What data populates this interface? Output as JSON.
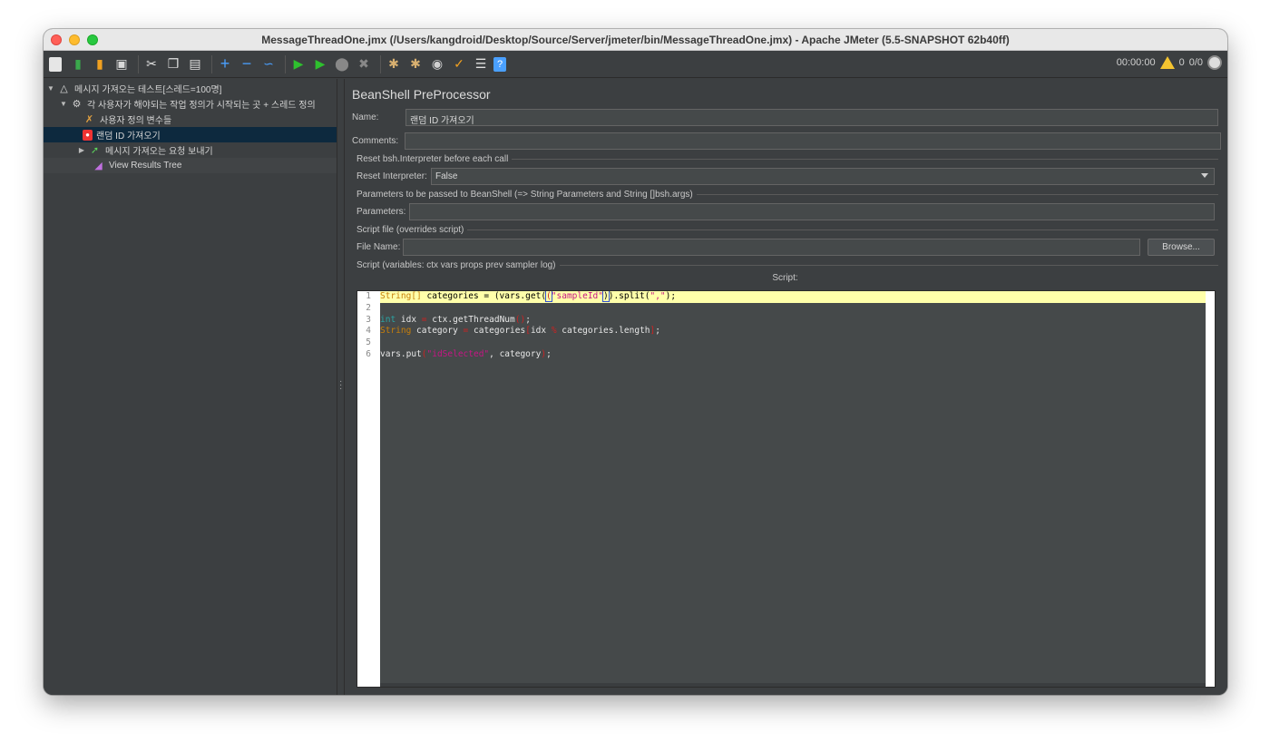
{
  "window": {
    "title": "MessageThreadOne.jmx (/Users/kangdroid/Desktop/Source/Server/jmeter/bin/MessageThreadOne.jmx) - Apache JMeter (5.5-SNAPSHOT 62b40ff)"
  },
  "toolbar": {
    "timer": "00:00:00",
    "warnings": "0",
    "threads": "0/0"
  },
  "tree": {
    "items": [
      {
        "label": "메시지 가져오는 테스트[스레드=100명]"
      },
      {
        "label": "각 사용자가 해야되는 작업 정의가 시작되는 곳 + 스레드 정의"
      },
      {
        "label": "사용자 정의 변수들"
      },
      {
        "label": "랜덤 ID 가져오기"
      },
      {
        "label": "메시지 가져오는 요청 보내기"
      },
      {
        "label": "View Results Tree"
      }
    ]
  },
  "panel": {
    "title": "BeanShell PreProcessor",
    "name_label": "Name:",
    "name_value": "랜덤 ID 가져오기",
    "comments_label": "Comments:",
    "comments_value": "",
    "reset_group": "Reset bsh.Interpreter before each call",
    "reset_label": "Reset Interpreter:",
    "reset_value": "False",
    "params_group": "Parameters to be passed to BeanShell (=> String Parameters and String []bsh.args)",
    "params_label": "Parameters:",
    "params_value": "",
    "file_group": "Script file (overrides script)",
    "file_label": "File Name:",
    "file_value": "",
    "browse_label": "Browse...",
    "script_group": "Script (variables: ctx vars props prev sampler log)",
    "script_label": "Script:"
  },
  "script": {
    "line_numbers": [
      "1",
      "2",
      "3",
      "4",
      "5",
      "6"
    ],
    "l1_type": "String[]",
    "l1_a": " categories = (vars.get(",
    "l1_paren": "(",
    "l1_str": "\"sampleId\"",
    "l1_b": ")",
    "l1_c": ").split(",
    "l1_d": "\",\"",
    "l1_e": ");",
    "l3_kw": "int",
    "l3_a": " idx ",
    "l3_eq": "=",
    "l3_b": " ctx.getThreadNum",
    "l3_c": "()",
    "l3_d": ";",
    "l4_kw": "String",
    "l4_a": " category ",
    "l4_eq": "=",
    "l4_b": " ",
    "l4_c": "categories",
    "l4_br": "[",
    "l4_d": "idx ",
    "l4_mod": "%",
    "l4_e": " categories.length",
    "l4_f": "]",
    "l4_g": ";",
    "l6_a": "vars.put",
    "l6_p": "(",
    "l6_str": "\"idSelected\"",
    "l6_b": ", category",
    "l6_c": ")",
    "l6_d": ";"
  }
}
